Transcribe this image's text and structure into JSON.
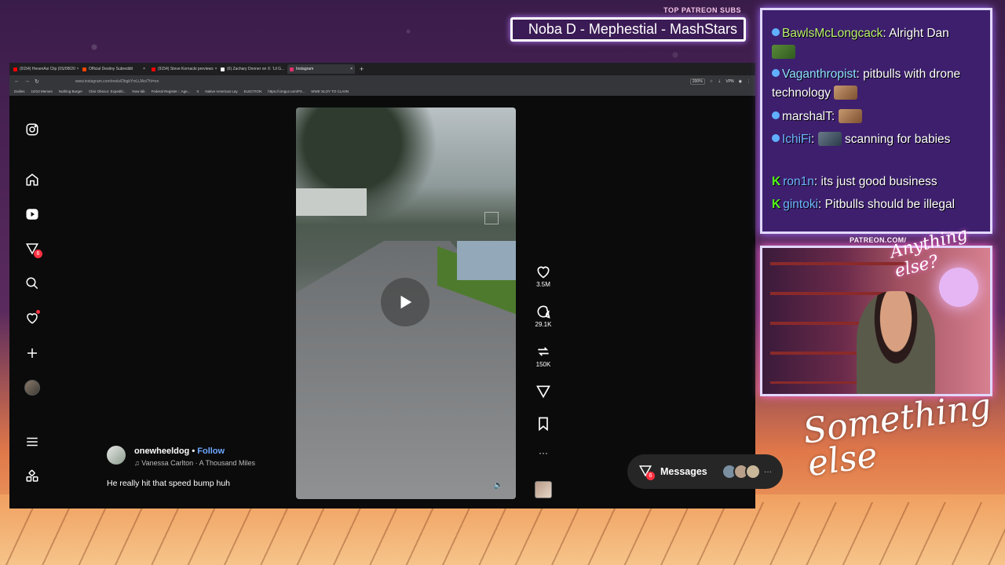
{
  "overlay": {
    "top_patreon_label": "TOP PATREON SUBS",
    "top_patreon_names": "Noba D - Mephestial - MashStars",
    "patreon_url": "PATREON.COM/",
    "cam_logo": "Anything else?",
    "brand": "Something else"
  },
  "browser": {
    "tabs": [
      {
        "title": "(9154) HesenAsi Clip (0S/0B/20",
        "color": "#ff0000"
      },
      {
        "title": "Official Destiny Subreddit",
        "color": "#ff4500"
      },
      {
        "title": "(9154) Steve Kornacki previews",
        "color": "#ff0000"
      },
      {
        "title": "(6) Zachary Donner on X: 'Lil G...",
        "color": "#ffffff"
      },
      {
        "title": "Instagram",
        "color": "#e1306c"
      }
    ],
    "url": "www.instagram.com/reels/DbgkYmLiJAo/?hl=en",
    "zoom": "200%",
    "vpn": "VPN",
    "bookmarks": [
      "Dailies",
      "10/10 Memes",
      "Nothing Burger",
      "Clair Obscur: Expediti...",
      "Now lab",
      "Federal Register :: Age...",
      "X",
      "Native American Lay",
      "ELECTION",
      "https://i.imgur.com/P3...",
      "WWE SLOY TO CLAIIN"
    ]
  },
  "instagram": {
    "nav_badge": "6",
    "likes": "3.5M",
    "comments": "29.1K",
    "reposts": "150K",
    "username": "onewheeldog",
    "separator": " • ",
    "follow": "Follow",
    "audio": "Vanessa Carlton · A Thousand Miles",
    "caption": "He really hit that speed bump huh",
    "messages_label": "Messages",
    "messages_badge": "6",
    "more": "···"
  },
  "chat": [
    {
      "name": "BawlsMcLongcack",
      "text": ": Alright Dan",
      "name_class": "g",
      "badge": "dot"
    },
    {
      "name": "Vaganthropist",
      "text": ": pitbulls with drone technology",
      "name_class": "",
      "badge": "dot"
    },
    {
      "name": "marshalT",
      "text": ":",
      "name_class": "",
      "badge": "dot"
    },
    {
      "name": "IchiFi",
      "text": ":",
      "text2": "scanning for babies",
      "name_class": "b",
      "badge": "dot"
    },
    {
      "name": "ron1n",
      "text": ": its just good business",
      "name_class": "b",
      "badge": "K"
    },
    {
      "name": "gintoki",
      "text": ": Pitbulls should be illegal",
      "name_class": "b",
      "badge": "K"
    }
  ]
}
